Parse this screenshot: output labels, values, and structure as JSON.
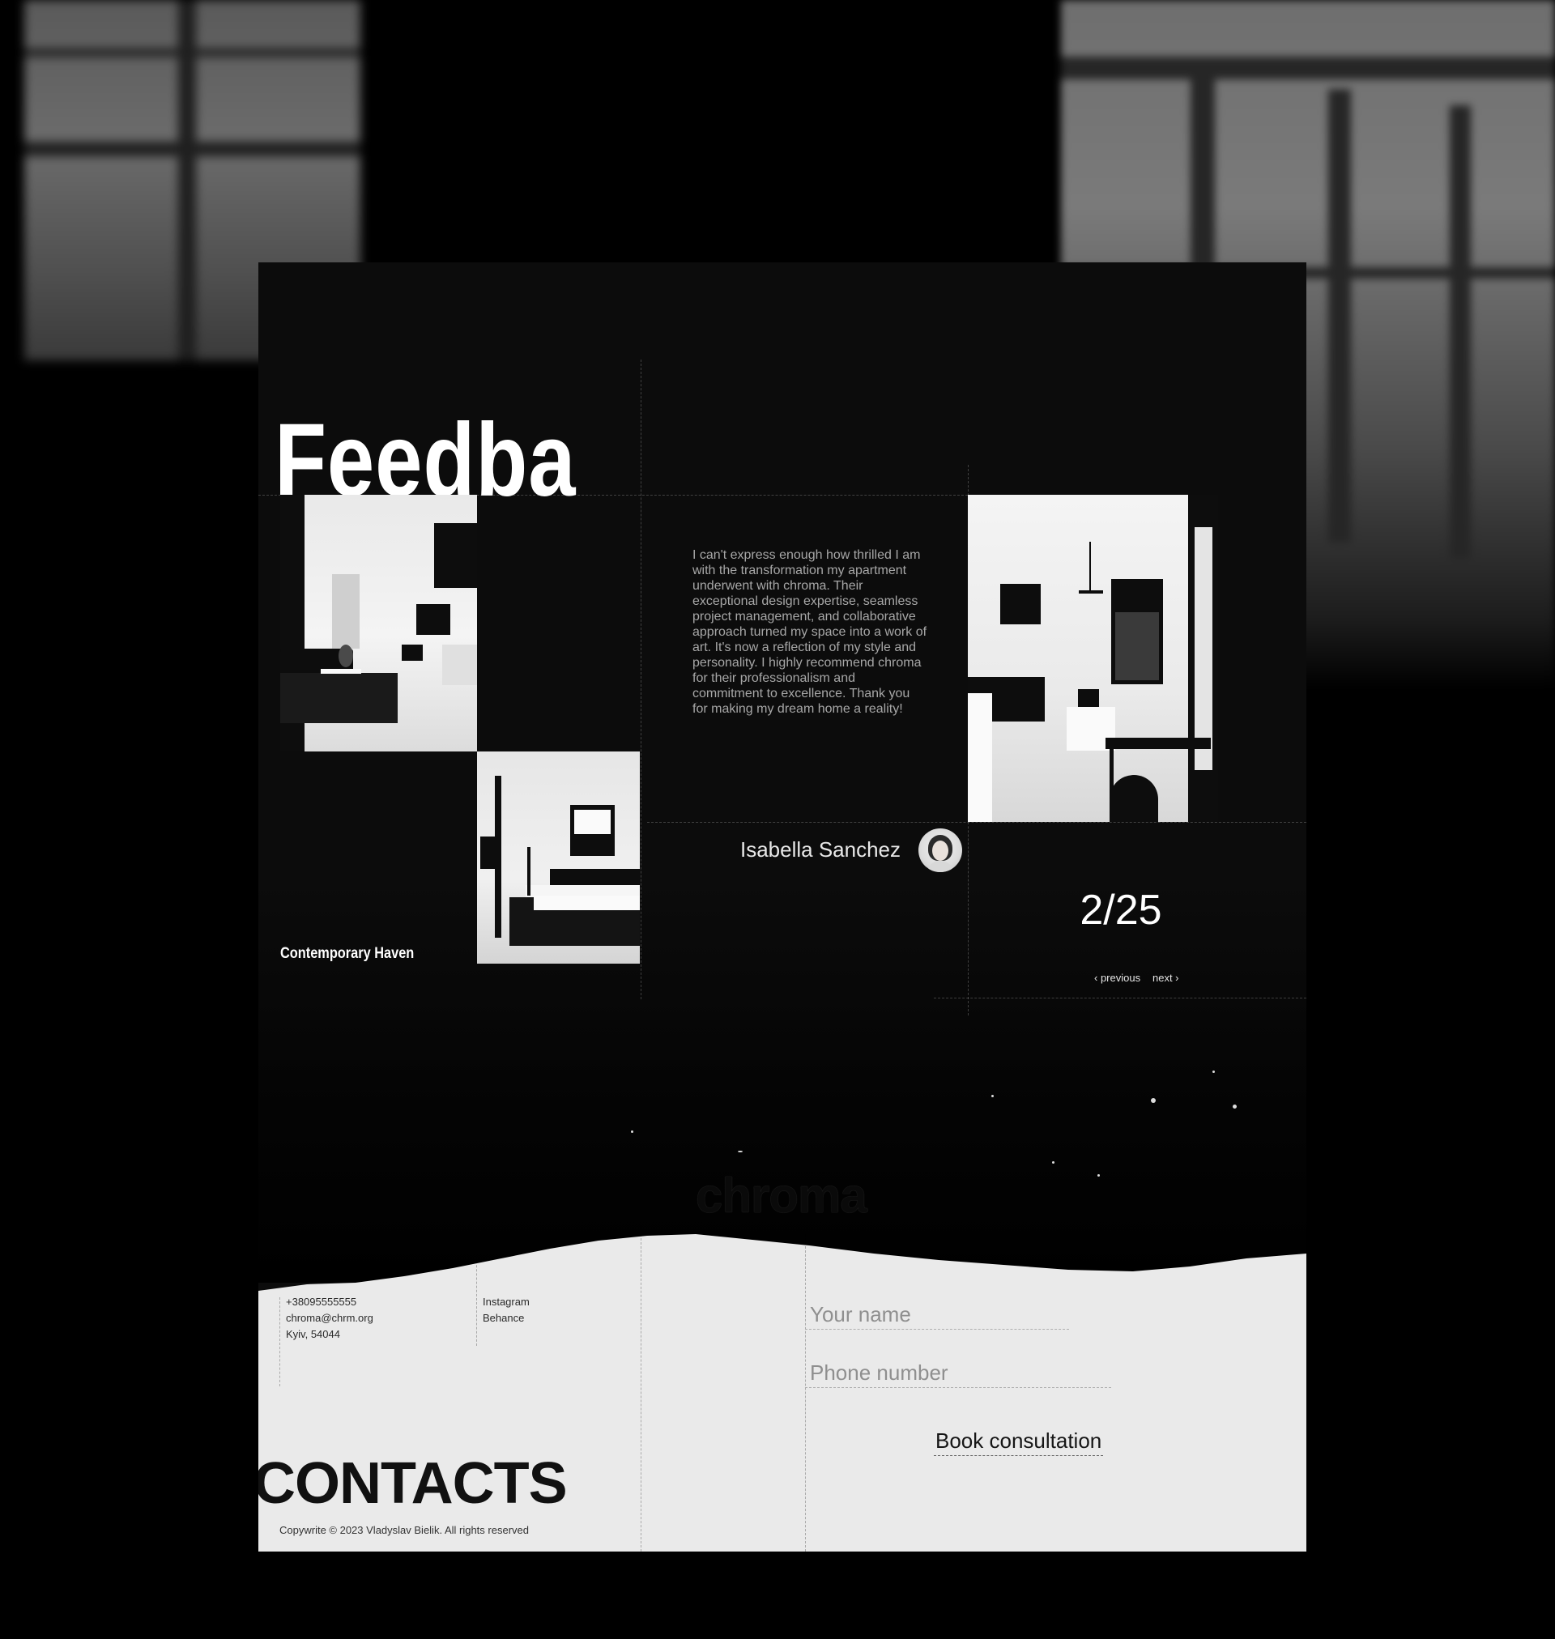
{
  "feedback": {
    "headline": "Feedback",
    "project_title": "Contemporary Haven",
    "quote": "I can't express enough how thrilled I am with the transformation my apartment underwent with chroma. Their exceptional design expertise, seamless project management, and collaborative approach turned my space into a work of art. It's now a reflection of my style and personality. I highly recommend chroma for their professionalism and commitment to excellence. Thank you for making my dream home a reality!",
    "author_name": "Isabella Sanchez",
    "counter": "2/25",
    "nav": {
      "previous": "‹ previous",
      "next": "next ›"
    }
  },
  "brand": {
    "logo": "chroma"
  },
  "contacts": {
    "phone": "+38095555555",
    "email": "chroma@chrm.org",
    "address": "Kyiv, 54044",
    "social": [
      "Instagram",
      "Behance"
    ],
    "title": "CONTACTS",
    "copyright": "Copywrite © 2023 Vladyslav Bielik. All rights reserved"
  },
  "form": {
    "name_placeholder": "Your name",
    "phone_placeholder": "Phone number",
    "submit_label": "Book consultation"
  },
  "icons": [
    "avatar-photo"
  ],
  "colors": {
    "dark_bg": "#0c0c0c",
    "light_bg": "#eaeaea",
    "text_light": "#ffffff",
    "text_dark": "#111111"
  }
}
